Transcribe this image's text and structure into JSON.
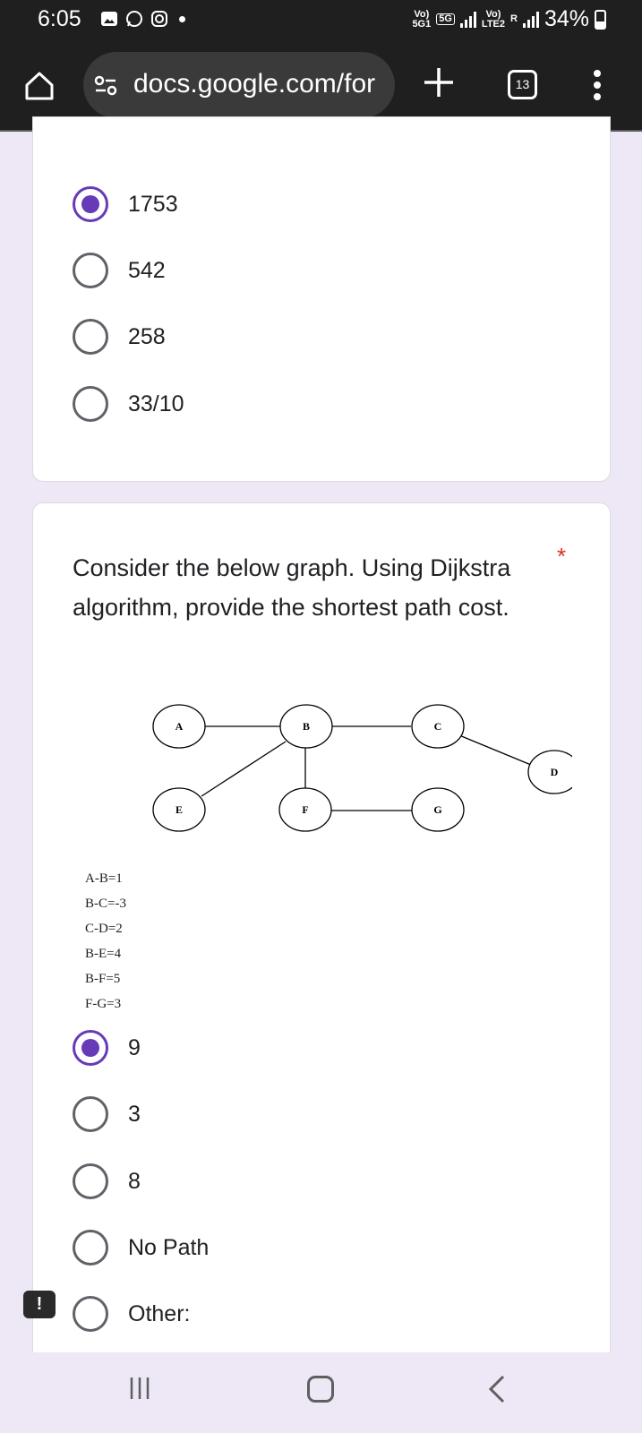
{
  "status_bar": {
    "time": "6:05",
    "carrier1_top": "Vo)",
    "carrier1_bottom": "5G1",
    "net_badge": "5G",
    "carrier2_top": "Vo)",
    "carrier2_bottom": "LTE2",
    "roaming": "R",
    "battery": "34%"
  },
  "browser": {
    "url": "docs.google.com/for",
    "tab_count": "13"
  },
  "question1": {
    "options": [
      {
        "label": "1753",
        "selected": true
      },
      {
        "label": "542",
        "selected": false
      },
      {
        "label": "258",
        "selected": false
      },
      {
        "label": "33/10",
        "selected": false
      }
    ]
  },
  "question2": {
    "text": "Consider the below graph. Using Dijkstra algorithm, provide the shortest path cost.",
    "required_mark": "*",
    "graph": {
      "nodes": [
        "A",
        "B",
        "C",
        "D",
        "E",
        "F",
        "G"
      ],
      "edges": [
        [
          "A",
          "B"
        ],
        [
          "B",
          "C"
        ],
        [
          "C",
          "D"
        ],
        [
          "B",
          "E"
        ],
        [
          "B",
          "F"
        ],
        [
          "F",
          "G"
        ]
      ]
    },
    "edge_weights": [
      "A-B=1",
      "B-C=-3",
      "C-D=2",
      "B-E=4",
      "B-F=5",
      "F-G=3"
    ],
    "options": [
      {
        "label": "9",
        "selected": true
      },
      {
        "label": "3",
        "selected": false
      },
      {
        "label": "8",
        "selected": false
      },
      {
        "label": "No Path",
        "selected": false
      },
      {
        "label": "Other:",
        "selected": false
      }
    ]
  },
  "feedback_icon": "!",
  "colors": {
    "accent": "#673ab7",
    "page_bg": "#ede7f6",
    "required": "#d93025"
  }
}
